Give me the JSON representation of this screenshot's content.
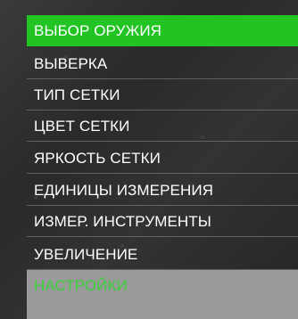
{
  "menu": {
    "items": [
      {
        "label": "ВЫБОР ОРУЖИЯ",
        "state": "selected"
      },
      {
        "label": "ВЫВЕРКА",
        "state": "normal"
      },
      {
        "label": "ТИП СЕТКИ",
        "state": "normal"
      },
      {
        "label": "ЦВЕТ СЕТКИ",
        "state": "normal"
      },
      {
        "label": "ЯРКОСТЬ СЕТКИ",
        "state": "normal"
      },
      {
        "label": "ЕДИНИЦЫ ИЗМЕРЕНИЯ",
        "state": "normal"
      },
      {
        "label": "ИЗМЕР. ИНСТРУМЕНТЫ",
        "state": "normal"
      },
      {
        "label": "УВЕЛИЧЕНИЕ",
        "state": "normal"
      },
      {
        "label": "НАСТРОЙКИ",
        "state": "dimmed"
      }
    ]
  },
  "colors": {
    "selected_background": "#22c424",
    "dimmed_background": "#9a9a9a",
    "dimmed_text": "#3ad13a",
    "text": "#ffffff"
  }
}
